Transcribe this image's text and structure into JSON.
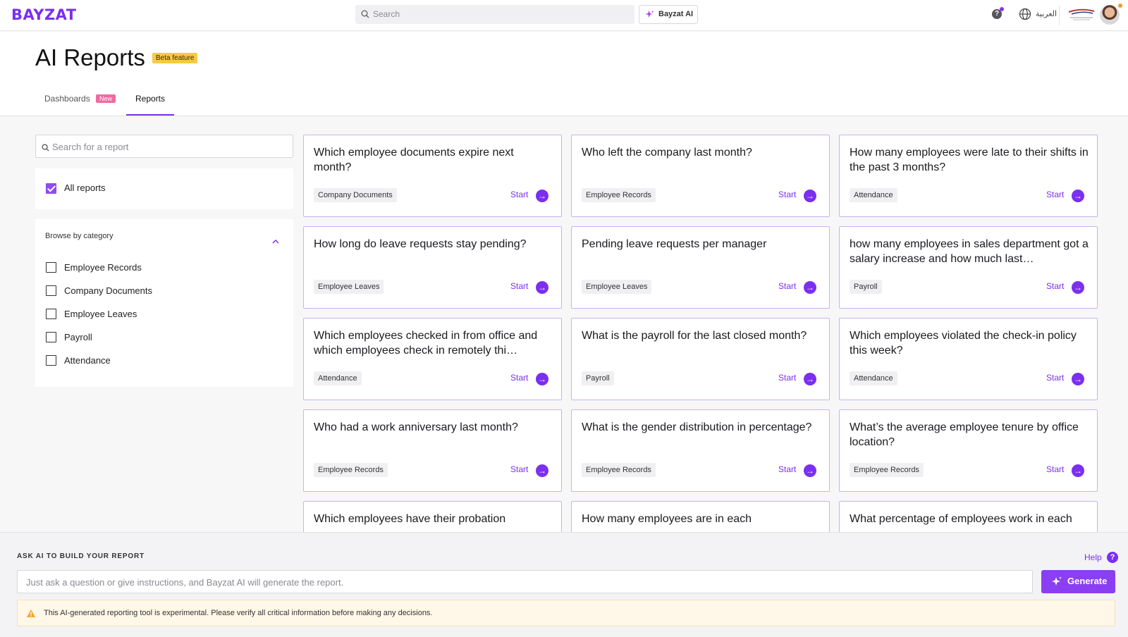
{
  "app": {
    "logo": "BAYZAT"
  },
  "topbar": {
    "search_placeholder": "Search",
    "ai_button": "Bayzat AI",
    "language": "العربية"
  },
  "page": {
    "title": "AI Reports",
    "beta_badge": "Beta feature"
  },
  "tabs": [
    {
      "label": "Dashboards",
      "badge": "New",
      "active": false
    },
    {
      "label": "Reports",
      "active": true
    }
  ],
  "filters": {
    "search_placeholder": "Search for a report",
    "all_reports": {
      "label": "All reports",
      "checked": true
    },
    "browse_label": "Browse by category",
    "categories": [
      {
        "label": "Employee Records",
        "checked": false
      },
      {
        "label": "Company Documents",
        "checked": false
      },
      {
        "label": "Employee Leaves",
        "checked": false
      },
      {
        "label": "Payroll",
        "checked": false
      },
      {
        "label": "Attendance",
        "checked": false
      }
    ]
  },
  "start_label": "Start",
  "cards": [
    {
      "question": "Which employee documents expire next month?",
      "category": "Company Documents"
    },
    {
      "question": "Who left the company last month?",
      "category": "Employee Records"
    },
    {
      "question": "How many employees were late to their shifts in the past 3 months?",
      "category": "Attendance"
    },
    {
      "question": "How long do leave requests stay pending?",
      "category": "Employee Leaves"
    },
    {
      "question": "Pending leave requests per manager",
      "category": "Employee Leaves"
    },
    {
      "question": "how many employees in sales department got a salary increase and how much last…",
      "category": "Payroll"
    },
    {
      "question": "Which employees checked in from office and which employees check in remotely thi…",
      "category": "Attendance"
    },
    {
      "question": "What is the payroll for the last closed month?",
      "category": "Payroll"
    },
    {
      "question": "Which employees violated the check-in policy this week?",
      "category": "Attendance"
    },
    {
      "question": "Who had a work anniversary last month?",
      "category": "Employee Records"
    },
    {
      "question": "What is the gender distribution in percentage?",
      "category": "Employee Records"
    },
    {
      "question": "What’s the average employee tenure by office location?",
      "category": "Employee Records"
    },
    {
      "question": "Which employees have their probation"
    },
    {
      "question": "How many employees are in each"
    },
    {
      "question": "What percentage of employees work in each"
    }
  ],
  "ask": {
    "title": "ASK AI TO BUILD YOUR REPORT",
    "help": "Help",
    "placeholder": "Just ask a question or give instructions, and Bayzat AI will generate the report.",
    "generate": "Generate",
    "warning": "This AI-generated reporting tool is experimental. Please verify all critical information before making any decisions."
  },
  "colors": {
    "accent": "#7b2ff0",
    "beta": "#f7c948",
    "new_badge": "#f06aa0",
    "card_border": "#c9b2f2"
  }
}
